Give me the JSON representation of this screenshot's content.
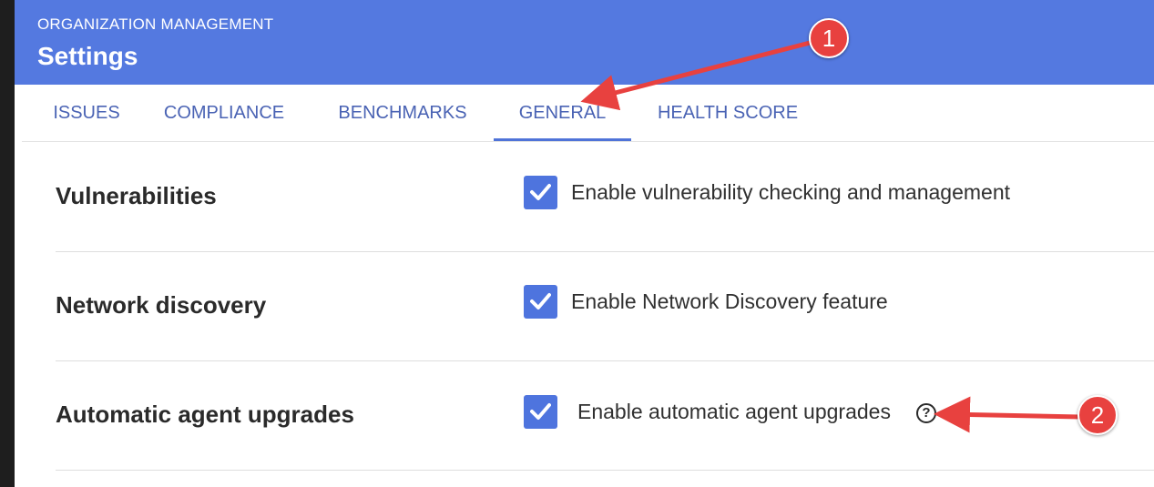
{
  "header": {
    "subtitle": "ORGANIZATION MANAGEMENT",
    "title": "Settings"
  },
  "tabs": [
    {
      "label": "ISSUES",
      "active": false
    },
    {
      "label": "COMPLIANCE",
      "active": false
    },
    {
      "label": "BENCHMARKS",
      "active": false
    },
    {
      "label": "GENERAL",
      "active": true
    },
    {
      "label": "HEALTH SCORE",
      "active": false
    }
  ],
  "settings": [
    {
      "label": "Vulnerabilities",
      "option": "Enable vulnerability checking and management",
      "checked": true,
      "help": false
    },
    {
      "label": "Network discovery",
      "option": "Enable Network Discovery feature",
      "checked": true,
      "help": false
    },
    {
      "label": "Automatic agent upgrades",
      "option": "Enable automatic agent upgrades",
      "checked": true,
      "help": true
    }
  ],
  "help_icon_glyph": "?",
  "annotations": [
    {
      "number": "1",
      "target": "tab-general"
    },
    {
      "number": "2",
      "target": "help-icon"
    }
  ],
  "colors": {
    "header_bg": "#5479e0",
    "accent": "#4e74de",
    "tab_text": "#4a63b4",
    "annotation": "#e8413f"
  }
}
